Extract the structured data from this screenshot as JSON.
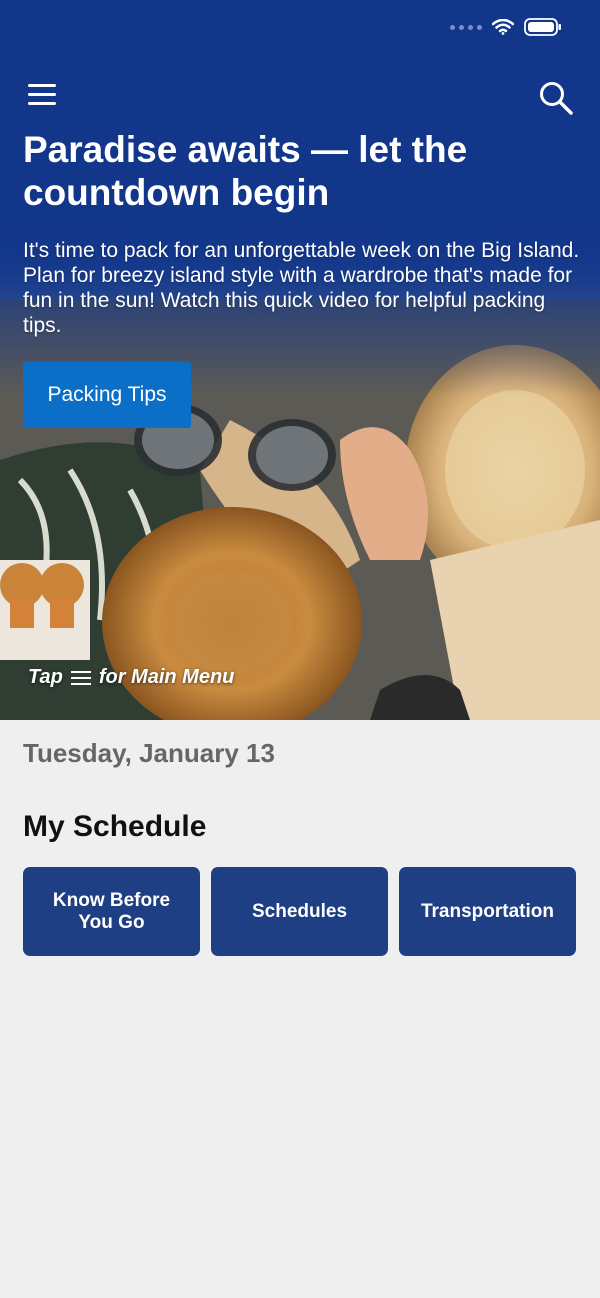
{
  "hero": {
    "title": "Paradise awaits — let the countdown begin",
    "description": "It's time to pack for an unforgettable week on the Big Island. Plan for breezy island style with a wardrobe that's made for fun in the sun! Watch this quick video for helpful packing tips.",
    "cta_label": "Packing Tips",
    "tap_hint_prefix": "Tap",
    "tap_hint_suffix": "for Main Menu"
  },
  "date": "Tuesday, January 13",
  "schedule": {
    "title": "My Schedule",
    "tiles": [
      {
        "label": "Know Before You Go"
      },
      {
        "label": "Schedules"
      },
      {
        "label": "Transportation"
      }
    ]
  },
  "colors": {
    "hero_blue": "#12368a",
    "cta_blue": "#0b6fc7",
    "tile_blue": "#1f3f84",
    "page_bg": "#efefef"
  },
  "icons": [
    "wifi-icon",
    "battery-icon",
    "hamburger-menu-icon",
    "search-icon"
  ]
}
